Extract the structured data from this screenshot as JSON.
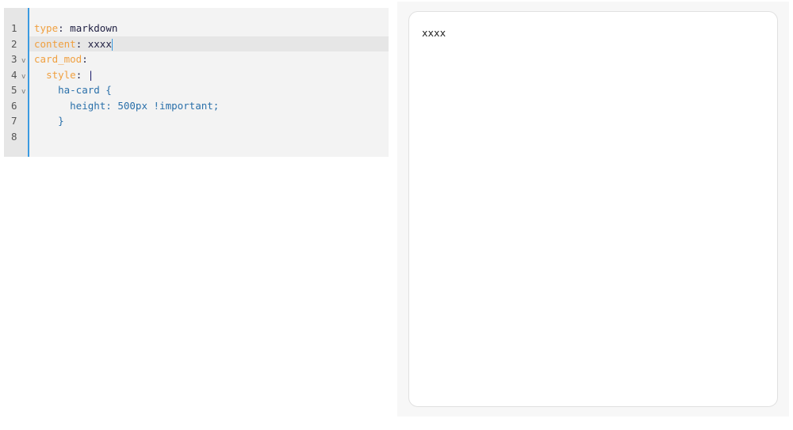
{
  "editor": {
    "lines": [
      {
        "num": "1",
        "key": "type",
        "sep": ": ",
        "val": "markdown"
      },
      {
        "num": "2",
        "key": "content",
        "sep": ": ",
        "val": "xxxx"
      },
      {
        "num": "3",
        "key": "card_mod",
        "sep": ":",
        "val": ""
      },
      {
        "num": "4",
        "indent": "  ",
        "key": "style",
        "sep": ": ",
        "val": "|"
      },
      {
        "num": "5",
        "text": "    ha-card {"
      },
      {
        "num": "6",
        "text": "      height: 500px !important;"
      },
      {
        "num": "7",
        "text": "    }"
      },
      {
        "num": "8",
        "text": ""
      }
    ],
    "fold_glyph": "v"
  },
  "preview": {
    "card_content": "xxxx"
  }
}
